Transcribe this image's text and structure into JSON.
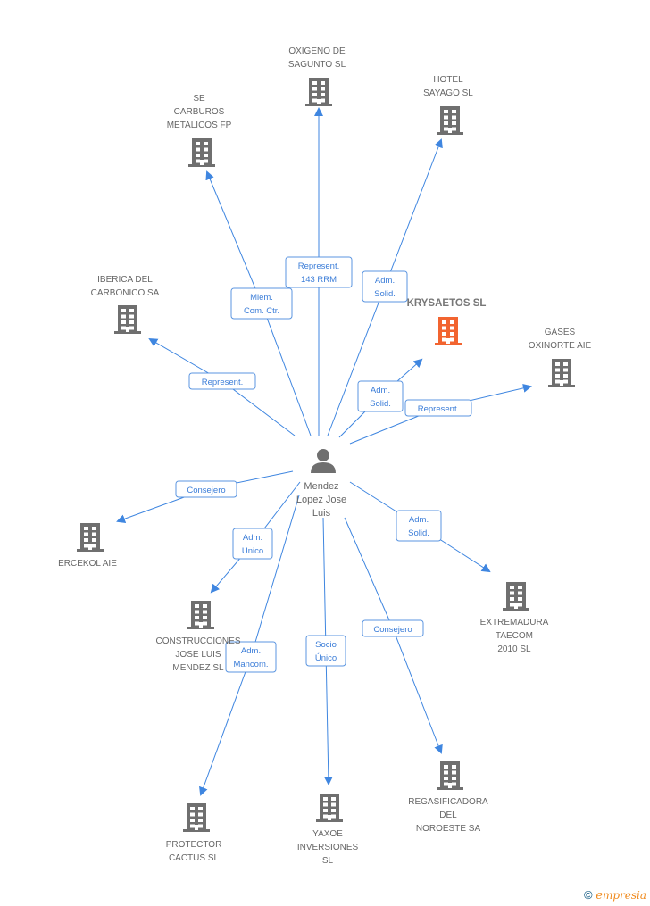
{
  "colors": {
    "edge": "#3f86e0",
    "node": "#6f6f6f",
    "highlight": "#f26430"
  },
  "person": {
    "name_lines": [
      "Mendez",
      "Lopez Jose",
      "Luis"
    ],
    "icon": "person-icon"
  },
  "nodes": [
    {
      "id": "oxigeno",
      "lines": [
        "OXIGENO DE",
        "SAGUNTO SL"
      ],
      "icon": "building-icon"
    },
    {
      "id": "hotel",
      "lines": [
        "HOTEL",
        "SAYAGO SL"
      ],
      "icon": "building-icon"
    },
    {
      "id": "carburos",
      "lines": [
        "SE",
        "CARBUROS",
        "METALICOS FP"
      ],
      "icon": "building-icon"
    },
    {
      "id": "iberica",
      "lines": [
        "IBERICA DEL",
        "CARBONICO SA"
      ],
      "icon": "building-icon"
    },
    {
      "id": "krysaetos",
      "lines": [
        "KRYSAETOS SL"
      ],
      "icon": "building-icon",
      "highlight": true
    },
    {
      "id": "gases",
      "lines": [
        "GASES",
        "OXINORTE AIE"
      ],
      "icon": "building-icon"
    },
    {
      "id": "ercekol",
      "lines": [
        "ERCEKOL AIE"
      ],
      "icon": "building-icon"
    },
    {
      "id": "construcciones",
      "lines": [
        "CONSTRUCCIONES",
        "JOSE LUIS",
        "MENDEZ SL"
      ],
      "icon": "building-icon"
    },
    {
      "id": "extremadura",
      "lines": [
        "EXTREMADURA",
        "TAECOM",
        "2010 SL"
      ],
      "icon": "building-icon"
    },
    {
      "id": "protector",
      "lines": [
        "PROTECTOR",
        "CACTUS  SL"
      ],
      "icon": "building-icon"
    },
    {
      "id": "yaxoe",
      "lines": [
        "YAXOE",
        "INVERSIONES",
        "SL"
      ],
      "icon": "building-icon"
    },
    {
      "id": "regasificadora",
      "lines": [
        "REGASIFICADORA",
        "DEL",
        "NOROESTE SA"
      ],
      "icon": "building-icon"
    }
  ],
  "edges": [
    {
      "to": "oxigeno",
      "label": [
        "Represent.",
        "143 RRM"
      ]
    },
    {
      "to": "hotel",
      "label": [
        "Adm.",
        "Solid."
      ]
    },
    {
      "to": "carburos",
      "label": [
        "Miem.",
        "Com. Ctr."
      ]
    },
    {
      "to": "iberica",
      "label": [
        "Represent."
      ]
    },
    {
      "to": "krysaetos",
      "label": [
        "Adm.",
        "Solid."
      ]
    },
    {
      "to": "gases",
      "label": [
        "Represent."
      ]
    },
    {
      "to": "ercekol",
      "label": [
        "Consejero"
      ]
    },
    {
      "to": "construcciones",
      "label": [
        "Adm.",
        "Unico"
      ]
    },
    {
      "to": "extremadura",
      "label": [
        "Adm.",
        "Solid."
      ]
    },
    {
      "to": "protector",
      "label": [
        "Adm.",
        "Mancom."
      ]
    },
    {
      "to": "yaxoe",
      "label": [
        "Socio",
        "Único"
      ]
    },
    {
      "to": "regasificadora",
      "label": [
        "Consejero"
      ]
    }
  ],
  "footer": {
    "copyright": "©",
    "brand_initial": "e",
    "brand_rest": "mpresia"
  }
}
